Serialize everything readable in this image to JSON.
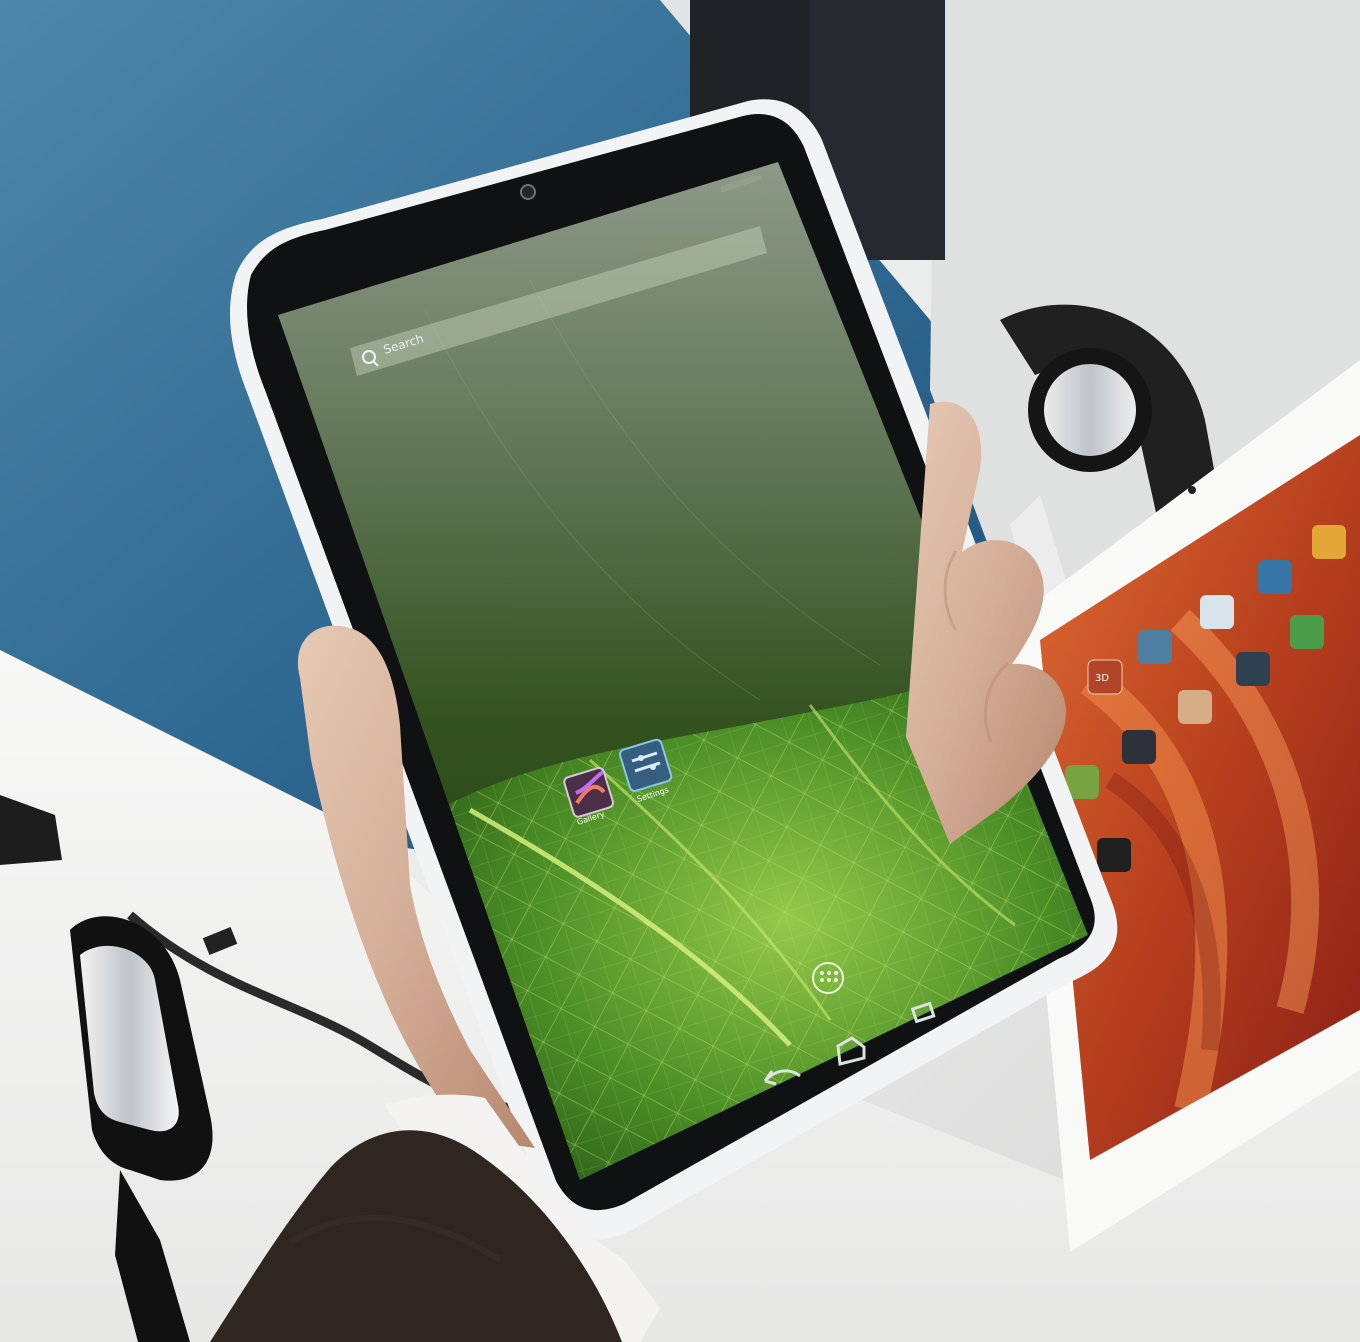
{
  "scene": {
    "colors": {
      "background_wall": "#d8dde0",
      "blue_table": "#3a6f93",
      "white_desk": "#f2f2f0",
      "tablet_frame": "#101214",
      "tablet_silver": "#d9dde2",
      "screen_top": "#7e8d78",
      "screen_mid": "#31501f",
      "leaf_green": "#3b7e24",
      "leaf_light": "#8cc43a",
      "orange_screen": "#d65d28",
      "hand_skin": "#d8b9a4",
      "sleeve": "#2f2622"
    }
  },
  "tablet": {
    "search_placeholder": "Search",
    "app_shortcuts": [
      {
        "name": "Gallery",
        "icon": "gallery-icon"
      },
      {
        "name": "Settings",
        "icon": "settings-icon"
      }
    ],
    "nav_buttons": [
      {
        "name": "Back",
        "icon": "back-icon"
      },
      {
        "name": "Home",
        "icon": "home-icon"
      },
      {
        "name": "Recents",
        "icon": "recents-icon"
      }
    ]
  },
  "background_tablet": {
    "visible_labels": [
      "3D"
    ]
  }
}
